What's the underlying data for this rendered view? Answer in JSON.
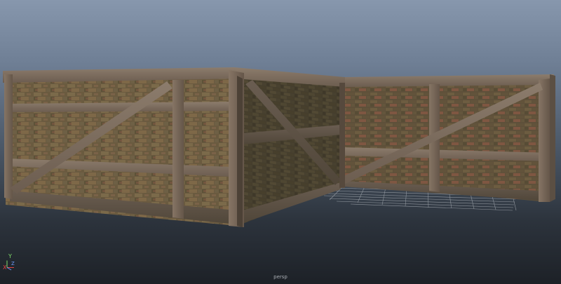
{
  "viewport": {
    "camera_label": "persp",
    "axis": {
      "x": "X",
      "y": "Y",
      "z": "Z"
    },
    "colors": {
      "background_top": "#8797ad",
      "background_bottom": "#1d2127",
      "grid": "#b7bcc2",
      "brick": "#6c5c43",
      "mortar": "#8a7c62",
      "timber": "#7a6a5c",
      "axis_x": "#e04444",
      "axis_y": "#7fdc6a",
      "axis_z": "#6e9cff"
    },
    "scene_objects": [
      "brick-wall-left-front",
      "brick-wall-left-side",
      "brick-wall-right",
      "ground-grid"
    ]
  }
}
